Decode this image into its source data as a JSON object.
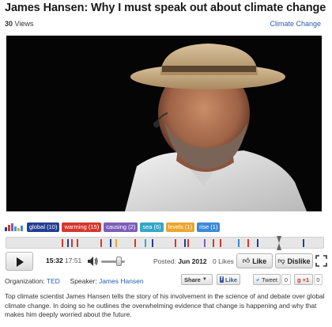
{
  "page": {
    "title": "James Hansen: Why I must speak out about climate change",
    "views_count": "30",
    "views_label": "Views",
    "category": "Climate Change"
  },
  "tags": [
    {
      "label": "global (10)",
      "color": "#233f92"
    },
    {
      "label": "warming (15)",
      "color": "#d7372c"
    },
    {
      "label": "causing (2)",
      "color": "#7d5db7"
    },
    {
      "label": "sea (6)",
      "color": "#33a7c6"
    },
    {
      "label": "levels (1)",
      "color": "#eba62d"
    },
    {
      "label": "rise (1)",
      "color": "#3a8ad9"
    }
  ],
  "timeline": {
    "progress": 0.86,
    "marks": [
      {
        "pos": 0.175,
        "color": "#d7372c"
      },
      {
        "pos": 0.192,
        "color": "#233f92"
      },
      {
        "pos": 0.205,
        "color": "#d7372c"
      },
      {
        "pos": 0.222,
        "color": "#d7372c"
      },
      {
        "pos": 0.298,
        "color": "#d7372c"
      },
      {
        "pos": 0.326,
        "color": "#233f92"
      },
      {
        "pos": 0.345,
        "color": "#eba62d"
      },
      {
        "pos": 0.405,
        "color": "#d7372c"
      },
      {
        "pos": 0.436,
        "color": "#33a7c6"
      },
      {
        "pos": 0.458,
        "color": "#233f92"
      },
      {
        "pos": 0.532,
        "color": "#d7372c"
      },
      {
        "pos": 0.56,
        "color": "#233f92"
      },
      {
        "pos": 0.572,
        "color": "#d7372c"
      },
      {
        "pos": 0.623,
        "color": "#7d5db7"
      },
      {
        "pos": 0.652,
        "color": "#d7372c"
      },
      {
        "pos": 0.674,
        "color": "#d7372c"
      },
      {
        "pos": 0.73,
        "color": "#3a8ad9"
      },
      {
        "pos": 0.76,
        "color": "#d7372c"
      },
      {
        "pos": 0.79,
        "color": "#233f92"
      },
      {
        "pos": 0.935,
        "color": "#233f92"
      }
    ]
  },
  "player": {
    "current_time": "15:32",
    "total_time": "17:51",
    "volume": 0.75,
    "posted_label": "Posted:",
    "posted_date": "Jun 2012",
    "likes_count": "0 Likes",
    "like_label": "Like",
    "dislike_label": "Dislike"
  },
  "meta": {
    "organization_label": "Organization:",
    "organization": "TED",
    "speaker_label": "Speaker:",
    "speaker": "James Hansen"
  },
  "social": {
    "share_label": "Share",
    "fb_like_label": "Like",
    "tweet_label": "Tweet",
    "tweet_count": "0",
    "gplus_label": "+1",
    "gplus_count": "0"
  },
  "description": "Top climate scientist James Hansen tells the story of his involvement in the science of and debate over global climate change. In doing so he outlines the overwhelming evidence that change is happening and why that makes him deeply worried about the future.",
  "icons": [
    "bars-chart-icon",
    "play-icon",
    "volume-icon",
    "thumbs-up-icon",
    "thumbs-down-icon",
    "fullscreen-icon",
    "dropdown-arrow-icon",
    "facebook-icon",
    "twitter-icon",
    "google-plus-icon"
  ]
}
